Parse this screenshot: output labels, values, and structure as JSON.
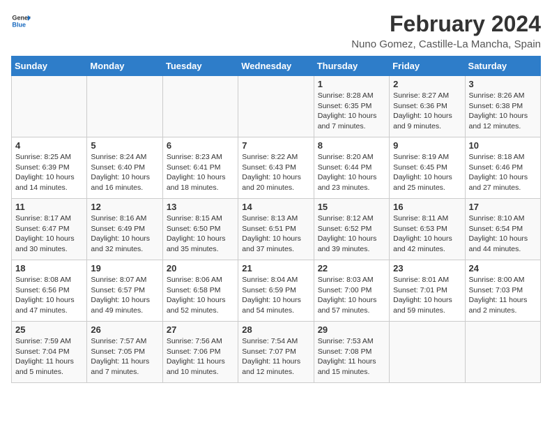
{
  "header": {
    "logo_line1": "General",
    "logo_line2": "Blue",
    "title": "February 2024",
    "subtitle": "Nuno Gomez, Castille-La Mancha, Spain"
  },
  "days_of_week": [
    "Sunday",
    "Monday",
    "Tuesday",
    "Wednesday",
    "Thursday",
    "Friday",
    "Saturday"
  ],
  "weeks": [
    [
      {
        "day": "",
        "info": ""
      },
      {
        "day": "",
        "info": ""
      },
      {
        "day": "",
        "info": ""
      },
      {
        "day": "",
        "info": ""
      },
      {
        "day": "1",
        "info": "Sunrise: 8:28 AM\nSunset: 6:35 PM\nDaylight: 10 hours\nand 7 minutes."
      },
      {
        "day": "2",
        "info": "Sunrise: 8:27 AM\nSunset: 6:36 PM\nDaylight: 10 hours\nand 9 minutes."
      },
      {
        "day": "3",
        "info": "Sunrise: 8:26 AM\nSunset: 6:38 PM\nDaylight: 10 hours\nand 12 minutes."
      }
    ],
    [
      {
        "day": "4",
        "info": "Sunrise: 8:25 AM\nSunset: 6:39 PM\nDaylight: 10 hours\nand 14 minutes."
      },
      {
        "day": "5",
        "info": "Sunrise: 8:24 AM\nSunset: 6:40 PM\nDaylight: 10 hours\nand 16 minutes."
      },
      {
        "day": "6",
        "info": "Sunrise: 8:23 AM\nSunset: 6:41 PM\nDaylight: 10 hours\nand 18 minutes."
      },
      {
        "day": "7",
        "info": "Sunrise: 8:22 AM\nSunset: 6:43 PM\nDaylight: 10 hours\nand 20 minutes."
      },
      {
        "day": "8",
        "info": "Sunrise: 8:20 AM\nSunset: 6:44 PM\nDaylight: 10 hours\nand 23 minutes."
      },
      {
        "day": "9",
        "info": "Sunrise: 8:19 AM\nSunset: 6:45 PM\nDaylight: 10 hours\nand 25 minutes."
      },
      {
        "day": "10",
        "info": "Sunrise: 8:18 AM\nSunset: 6:46 PM\nDaylight: 10 hours\nand 27 minutes."
      }
    ],
    [
      {
        "day": "11",
        "info": "Sunrise: 8:17 AM\nSunset: 6:47 PM\nDaylight: 10 hours\nand 30 minutes."
      },
      {
        "day": "12",
        "info": "Sunrise: 8:16 AM\nSunset: 6:49 PM\nDaylight: 10 hours\nand 32 minutes."
      },
      {
        "day": "13",
        "info": "Sunrise: 8:15 AM\nSunset: 6:50 PM\nDaylight: 10 hours\nand 35 minutes."
      },
      {
        "day": "14",
        "info": "Sunrise: 8:13 AM\nSunset: 6:51 PM\nDaylight: 10 hours\nand 37 minutes."
      },
      {
        "day": "15",
        "info": "Sunrise: 8:12 AM\nSunset: 6:52 PM\nDaylight: 10 hours\nand 39 minutes."
      },
      {
        "day": "16",
        "info": "Sunrise: 8:11 AM\nSunset: 6:53 PM\nDaylight: 10 hours\nand 42 minutes."
      },
      {
        "day": "17",
        "info": "Sunrise: 8:10 AM\nSunset: 6:54 PM\nDaylight: 10 hours\nand 44 minutes."
      }
    ],
    [
      {
        "day": "18",
        "info": "Sunrise: 8:08 AM\nSunset: 6:56 PM\nDaylight: 10 hours\nand 47 minutes."
      },
      {
        "day": "19",
        "info": "Sunrise: 8:07 AM\nSunset: 6:57 PM\nDaylight: 10 hours\nand 49 minutes."
      },
      {
        "day": "20",
        "info": "Sunrise: 8:06 AM\nSunset: 6:58 PM\nDaylight: 10 hours\nand 52 minutes."
      },
      {
        "day": "21",
        "info": "Sunrise: 8:04 AM\nSunset: 6:59 PM\nDaylight: 10 hours\nand 54 minutes."
      },
      {
        "day": "22",
        "info": "Sunrise: 8:03 AM\nSunset: 7:00 PM\nDaylight: 10 hours\nand 57 minutes."
      },
      {
        "day": "23",
        "info": "Sunrise: 8:01 AM\nSunset: 7:01 PM\nDaylight: 10 hours\nand 59 minutes."
      },
      {
        "day": "24",
        "info": "Sunrise: 8:00 AM\nSunset: 7:03 PM\nDaylight: 11 hours\nand 2 minutes."
      }
    ],
    [
      {
        "day": "25",
        "info": "Sunrise: 7:59 AM\nSunset: 7:04 PM\nDaylight: 11 hours\nand 5 minutes."
      },
      {
        "day": "26",
        "info": "Sunrise: 7:57 AM\nSunset: 7:05 PM\nDaylight: 11 hours\nand 7 minutes."
      },
      {
        "day": "27",
        "info": "Sunrise: 7:56 AM\nSunset: 7:06 PM\nDaylight: 11 hours\nand 10 minutes."
      },
      {
        "day": "28",
        "info": "Sunrise: 7:54 AM\nSunset: 7:07 PM\nDaylight: 11 hours\nand 12 minutes."
      },
      {
        "day": "29",
        "info": "Sunrise: 7:53 AM\nSunset: 7:08 PM\nDaylight: 11 hours\nand 15 minutes."
      },
      {
        "day": "",
        "info": ""
      },
      {
        "day": "",
        "info": ""
      }
    ]
  ]
}
